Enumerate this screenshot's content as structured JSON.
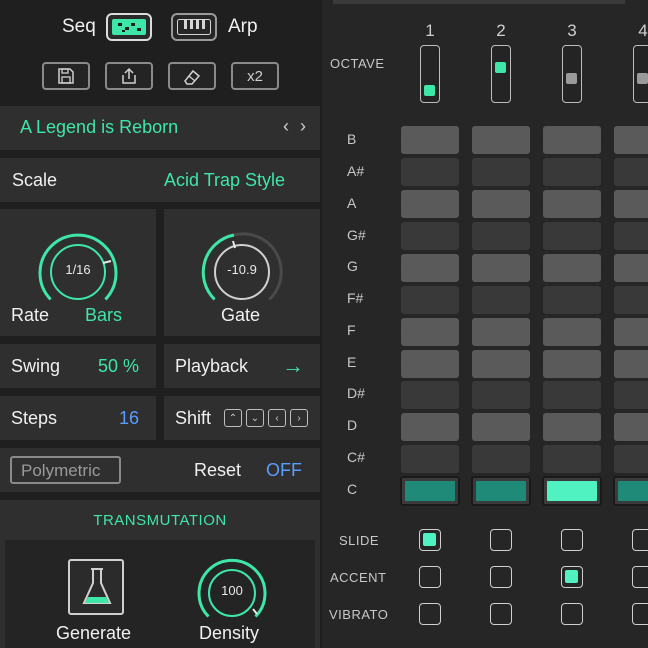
{
  "toolbar": {
    "seq_label": "Seq",
    "arp_label": "Arp",
    "x2_label": "x2"
  },
  "preset": {
    "name": "A Legend is Reborn",
    "prev": "‹",
    "next": "›"
  },
  "scale": {
    "label": "Scale",
    "value": "Acid Trap Style"
  },
  "rate": {
    "label": "Rate",
    "value": "1/16",
    "unit": "Bars"
  },
  "gate": {
    "label": "Gate",
    "value": "-10.9"
  },
  "swing": {
    "label": "Swing",
    "value": "50 %"
  },
  "playback": {
    "label": "Playback",
    "value": "→"
  },
  "steps": {
    "label": "Steps",
    "value": "16"
  },
  "shift": {
    "label": "Shift"
  },
  "polymetric": {
    "label": "Polymetric"
  },
  "reset": {
    "label": "Reset",
    "value": "OFF"
  },
  "transmutation": {
    "title": "TRANSMUTATION",
    "generate_label": "Generate",
    "density_label": "Density",
    "density_value": "100"
  },
  "grid": {
    "octave_label": "OCTAVE",
    "columns": [
      "1",
      "2",
      "3",
      "4"
    ],
    "notes": [
      "B",
      "A#",
      "A",
      "G#",
      "G",
      "F#",
      "F",
      "E",
      "D#",
      "D",
      "C#",
      "C"
    ],
    "selected_active_column": "3"
  },
  "rows": {
    "slide_label": "SLIDE",
    "accent_label": "ACCENT",
    "vibrato_label": "VIBRATO"
  },
  "colors": {
    "accent": "#3ee6a8",
    "blue": "#5b9cff",
    "panel": "#2f2f2f",
    "grid_white_key": "#5a5a5a",
    "grid_black_key": "#393939"
  }
}
